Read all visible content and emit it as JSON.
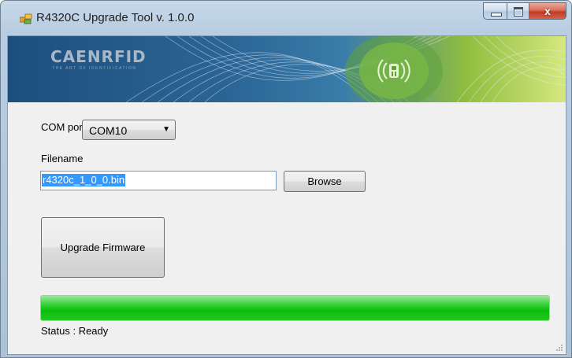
{
  "window": {
    "title": "R4320C Upgrade Tool v. 1.0.0",
    "close_glyph": "x",
    "minimize_icon": "minimize-icon",
    "maximize_icon": "maximize-icon",
    "app_icon": "window-app-icon"
  },
  "banner": {
    "brand": "CAENRFID",
    "tagline": "THE ART OF IDENTIFICATION",
    "logo_icon": "caen-rfid-logo-icon"
  },
  "form": {
    "com_port_label": "COM port",
    "com_port_value": "COM10",
    "filename_label": "Filename",
    "filename_value": "r4320c_1_0_0.bin",
    "browse_label": "Browse",
    "upgrade_label": "Upgrade Firmware",
    "progress_fraction": 1.0,
    "status_text": "Status : Ready"
  },
  "colors": {
    "progress_green": "#0bbf0b",
    "selection_blue": "#3399ff",
    "close_red": "#c13c22"
  }
}
